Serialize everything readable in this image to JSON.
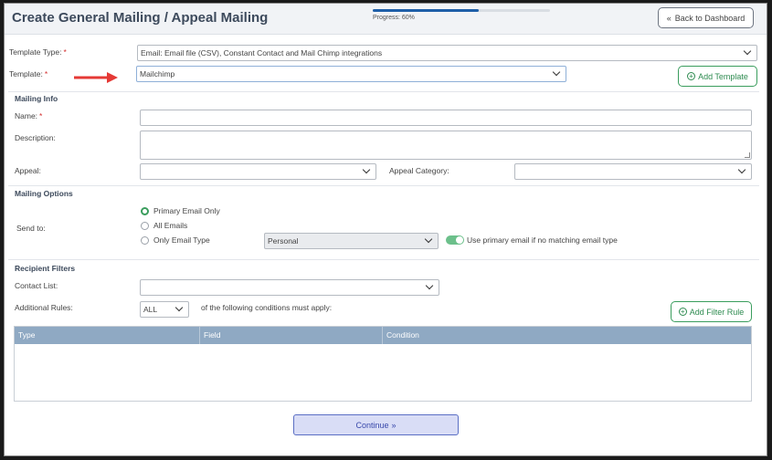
{
  "header": {
    "title": "Create General Mailing / Appeal Mailing",
    "progress_label": "Progress: 60%",
    "progress": 0.6,
    "back_label": "Back to Dashboard"
  },
  "template_type": {
    "label": "Template Type:",
    "value": "Email: Email file (CSV), Constant Contact and Mail Chimp integrations"
  },
  "template": {
    "label": "Template:",
    "value": "Mailchimp",
    "add_label": "Add Template"
  },
  "mailing_info": {
    "title": "Mailing Info",
    "name_label": "Name:",
    "name_value": "",
    "description_label": "Description:",
    "appeal_label": "Appeal:",
    "appeal_value": "",
    "appeal_category_label": "Appeal Category:",
    "appeal_category_value": ""
  },
  "mailing_options": {
    "title": "Mailing Options",
    "send_to_label": "Send to:",
    "options": [
      "Primary Email Only",
      "All Emails",
      "Only Email Type"
    ],
    "selected": "Primary Email Only",
    "email_type_value": "Personal",
    "toggle_label": "Use primary email if no matching email type",
    "toggle_on": true
  },
  "recipient_filters": {
    "title": "Recipient Filters",
    "contact_list_label": "Contact List:",
    "contact_list_value": "",
    "additional_rules_label": "Additional Rules:",
    "rules_value": "ALL",
    "rules_suffix": "of the following conditions must apply:",
    "add_filter_label": "Add Filter Rule",
    "columns": [
      "Type",
      "Field",
      "Condition"
    ]
  },
  "continue_label": "Continue",
  "colors": {
    "accent_green": "#2e8b50",
    "progress_blue": "#1e5fa8",
    "table_header": "#8fa9c3",
    "continue_bg": "#d9ddf6",
    "arrow_red": "#e53935"
  },
  "icons": {
    "back": "double-chevron-left-icon",
    "add": "plus-circle-icon",
    "continue": "double-chevron-right-icon",
    "dropdown": "chevron-down-icon"
  }
}
